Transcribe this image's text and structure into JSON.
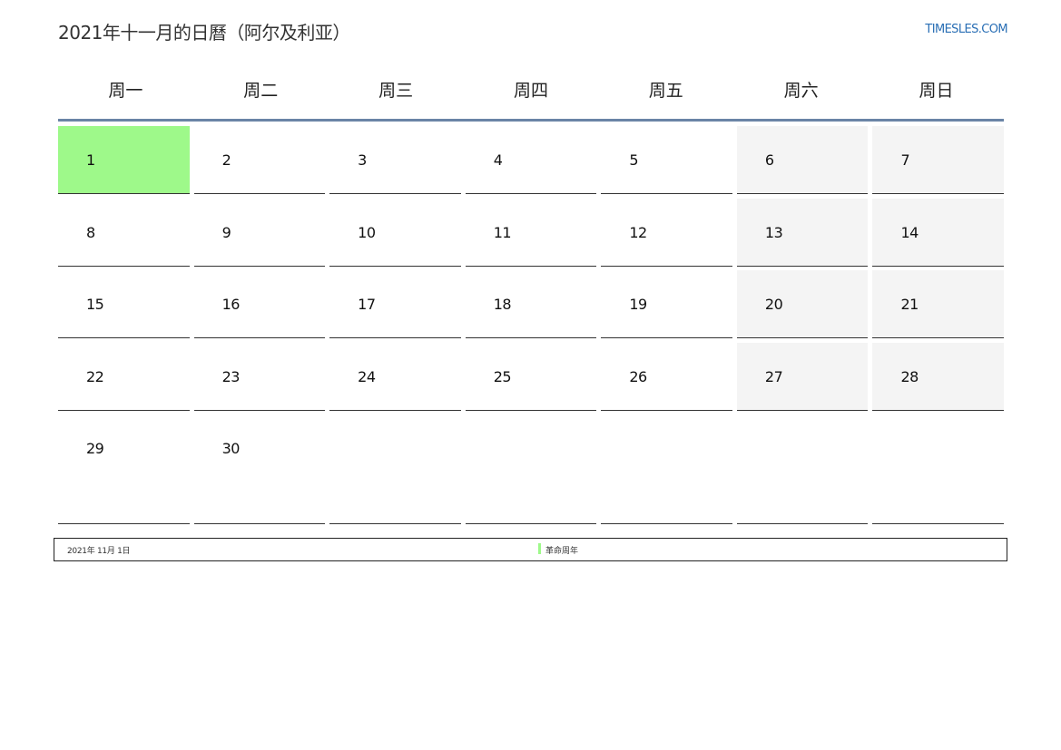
{
  "header": {
    "title": "2021年十一月的日曆（阿尔及利亚）",
    "site": "TIMESLES.COM"
  },
  "weekdays": [
    "周一",
    "周二",
    "周三",
    "周四",
    "周五",
    "周六",
    "周日"
  ],
  "weeks": [
    [
      "1",
      "2",
      "3",
      "4",
      "5",
      "6",
      "7"
    ],
    [
      "8",
      "9",
      "10",
      "11",
      "12",
      "13",
      "14"
    ],
    [
      "15",
      "16",
      "17",
      "18",
      "19",
      "20",
      "21"
    ],
    [
      "22",
      "23",
      "24",
      "25",
      "26",
      "27",
      "28"
    ],
    [
      "29",
      "30",
      "",
      "",
      "",
      "",
      ""
    ]
  ],
  "holiday_day": "1",
  "colors": {
    "holiday": "#9ef98a",
    "weekend": "#f4f4f4",
    "link": "#2a6fb5",
    "header_rule": "#6a84a6"
  },
  "holidays": [
    {
      "date": "2021年 11月 1日",
      "name": "革命周年"
    }
  ]
}
